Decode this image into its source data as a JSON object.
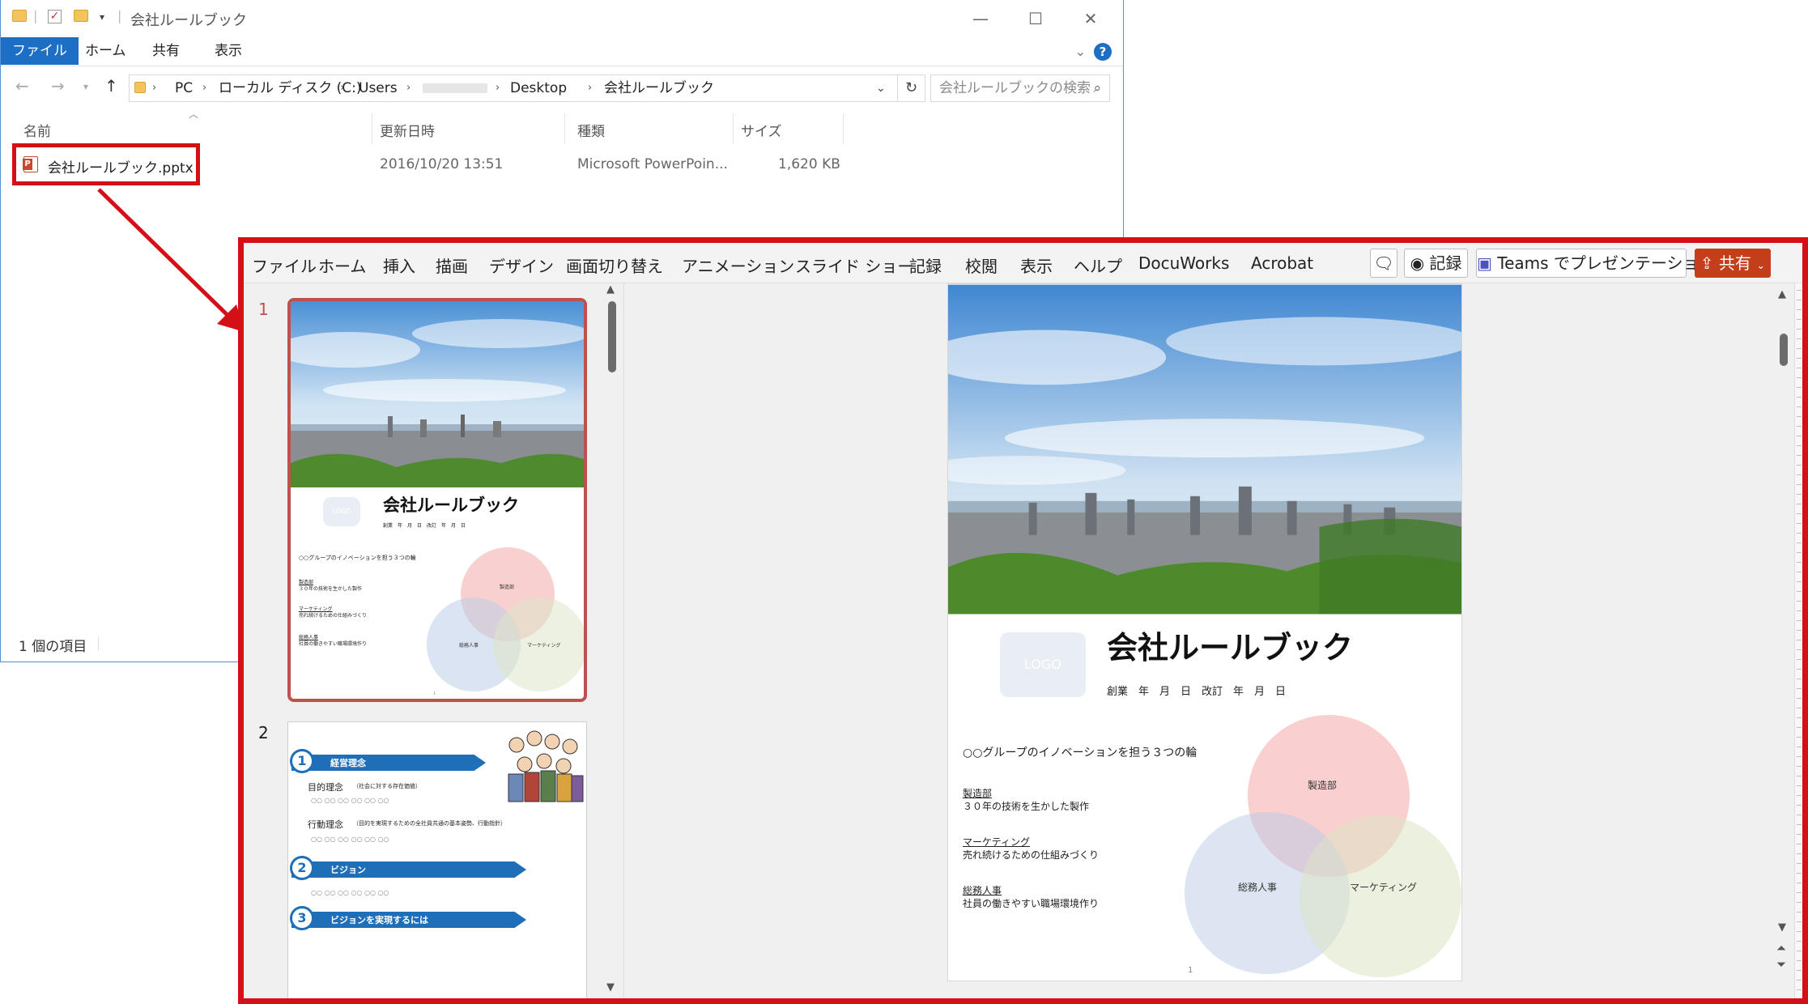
{
  "explorer": {
    "title": "会社ルールブック",
    "ribbon_tabs": [
      "ファイル",
      "ホーム",
      "共有",
      "表示"
    ],
    "address": {
      "segments": [
        "PC",
        "ローカル ディスク (C:)",
        "Users",
        "Desktop",
        "会社ルールブック"
      ]
    },
    "search_placeholder": "会社ルールブックの検索",
    "columns": {
      "name": "名前",
      "modified": "更新日時",
      "type": "種類",
      "size": "サイズ"
    },
    "file": {
      "name": "会社ルールブック.pptx",
      "modified": "2016/10/20 13:51",
      "type": "Microsoft PowerPoin...",
      "size": "1,620 KB"
    },
    "status": "1 個の項目"
  },
  "powerpoint": {
    "menu": [
      "ファイル",
      "ホーム",
      "挿入",
      "描画",
      "デザイン",
      "画面切り替え",
      "アニメーション",
      "スライド ショー",
      "記録",
      "校閲",
      "表示",
      "ヘルプ",
      "DocuWorks",
      "Acrobat"
    ],
    "record_label": "記録",
    "teams_label": "Teams でプレゼンテーション",
    "share_label": "共有",
    "slide_numbers": [
      "1",
      "2"
    ]
  },
  "slide1": {
    "logo": "LOGO",
    "title": "会社ルールブック",
    "date_line": "創業　年　月　日　改訂　年　月　日",
    "intro": "○○グループのイノベーションを担う３つの輪",
    "items": [
      {
        "heading": "製造部",
        "desc": "３０年の技術を生かした製作"
      },
      {
        "heading": "マーケティング",
        "desc": "売れ続けるための仕組みづくり"
      },
      {
        "heading": "総務人事",
        "desc": "社員の働きやすい職場環境作り"
      }
    ],
    "venn": [
      "製造部",
      "総務人事",
      "マーケティング"
    ],
    "page": "1"
  },
  "slide2": {
    "sections": [
      {
        "num": "1",
        "label": "経営理念"
      },
      {
        "num": "2",
        "label": "ビジョン"
      },
      {
        "num": "3",
        "label": "ビジョンを実現するには"
      }
    ],
    "rows": [
      {
        "title": "目的理念",
        "note": "（社会に対する存在価値）",
        "dots": "○○ ○○ ○○ ○○ ○○ ○○"
      },
      {
        "title": "行動理念",
        "note": "（目的を実現するための全社員共通の基本姿勢、行動指針）",
        "dots": "○○ ○○ ○○ ○○ ○○ ○○"
      }
    ],
    "vision_dots": "○○ ○○ ○○ ○○ ○○ ○○"
  },
  "colors": {
    "highlight": "#d50f16",
    "explorer_accent": "#1d6fc6",
    "ppt_share": "#c43e1c",
    "ribbon_blue": "#1e6fb8"
  }
}
